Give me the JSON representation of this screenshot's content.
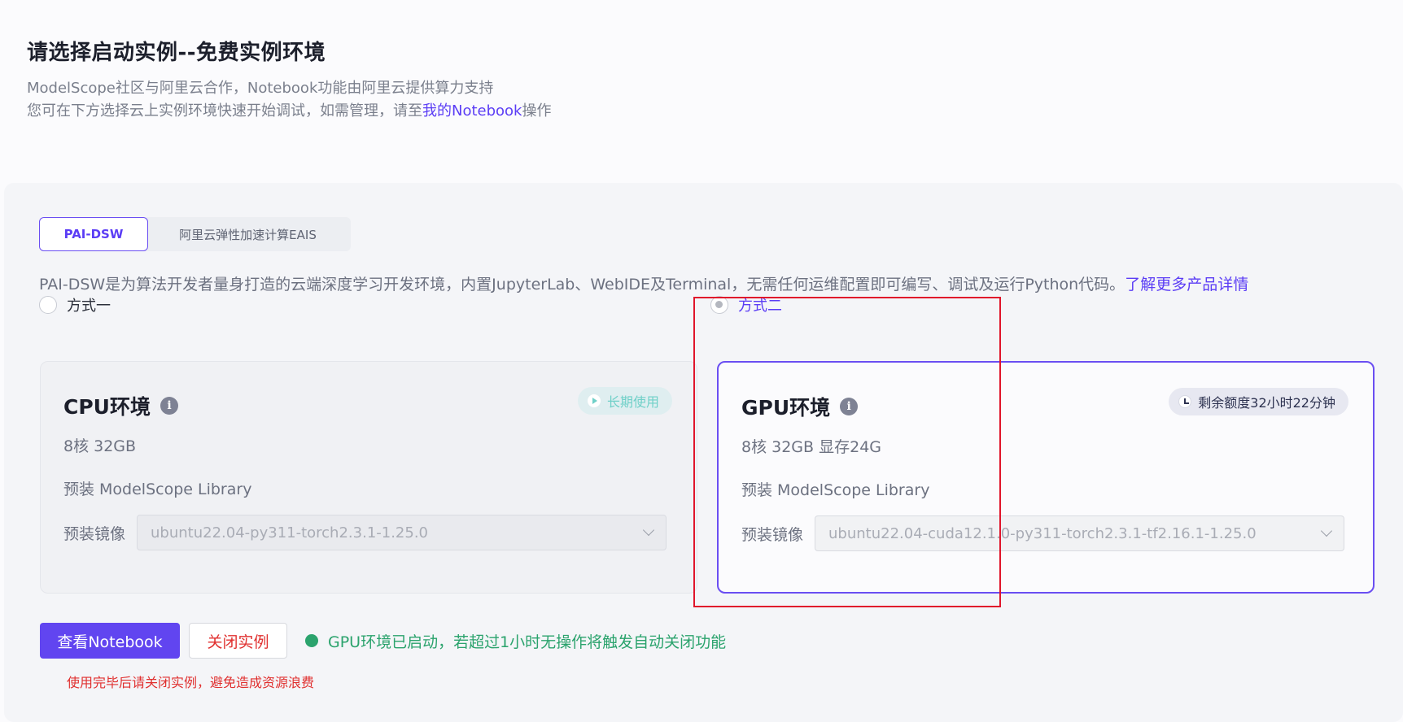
{
  "header": {
    "title": "请选择启动实例--免费实例环境",
    "line1": "ModelScope社区与阿里云合作，Notebook功能由阿里云提供算力支持",
    "line2_prefix": "您可在下方选择云上实例环境快速开始调试，如需管理，请至",
    "line2_link": "我的Notebook",
    "line2_suffix": "操作"
  },
  "tabs": [
    {
      "label": "PAI-DSW",
      "active": true
    },
    {
      "label": "阿里云弹性加速计算EAIS",
      "active": false
    }
  ],
  "description": {
    "text": "PAI-DSW是为算法开发者量身打造的云端深度学习开发环境，内置JupyterLab、WebIDE及Terminal，无需任何运维配置即可编写、调试及运行Python代码。",
    "link": "了解更多产品详情"
  },
  "options": [
    {
      "label": "方式一",
      "checked": false
    },
    {
      "label": "方式二",
      "checked": true
    }
  ],
  "cpu_card": {
    "title": "CPU环境",
    "badge": "长期使用",
    "spec": "8核 32GB",
    "library": "预装 ModelScope Library",
    "image_label": "预装镜像",
    "image_value": "ubuntu22.04-py311-torch2.3.1-1.25.0"
  },
  "gpu_card": {
    "title": "GPU环境",
    "badge": "剩余额度32小时22分钟",
    "spec": "8核 32GB 显存24G",
    "library": "预装 ModelScope Library",
    "image_label": "预装镜像",
    "image_value": "ubuntu22.04-cuda12.1.0-py311-torch2.3.1-tf2.16.1-1.25.0"
  },
  "actions": {
    "view_notebook": "查看Notebook",
    "close_instance": "关闭实例",
    "status": "GPU环境已启动，若超过1小时无操作将触发自动关闭功能",
    "hint": "使用完毕后请关闭实例，避免造成资源浪费"
  },
  "colors": {
    "accent": "#6145f0",
    "danger": "#e0302f",
    "success": "#2ba36d",
    "highlight_box": "#e0152b"
  }
}
